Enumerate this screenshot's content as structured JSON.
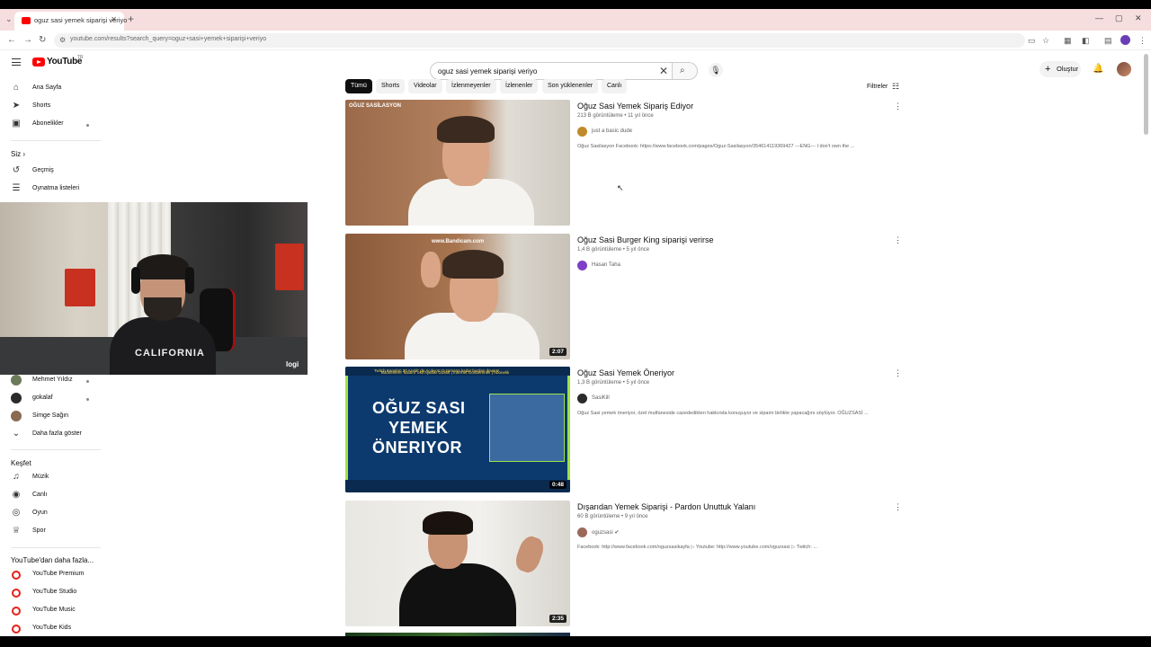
{
  "browser": {
    "tab_title": "oguz sasi yemek siparişi veriyo",
    "url": "youtube.com/results?search_query=oguz+sasi+yemek+siparişi+veriyo"
  },
  "header": {
    "logo": "YouTube",
    "country": "TR",
    "search_value": "oguz sasi yemek siparişi veriyo",
    "create_label": "Oluştur"
  },
  "sidebar": {
    "main": [
      {
        "label": "Ana Sayfa",
        "icon": "home-icon"
      },
      {
        "label": "Shorts",
        "icon": "shorts-icon"
      },
      {
        "label": "Abonelikler",
        "icon": "subscriptions-icon"
      }
    ],
    "you_title": "Siz",
    "you_items": [
      {
        "label": "Geçmiş",
        "icon": "history-icon"
      },
      {
        "label": "Oynatma listeleri",
        "icon": "playlist-icon"
      }
    ],
    "subscriptions": [
      {
        "label": "Mehmet Yıldız"
      },
      {
        "label": "gokalaf"
      },
      {
        "label": "Simge Sağın"
      }
    ],
    "show_more": "Daha fazla göster",
    "explore_title": "Keşfet",
    "explore_items": [
      {
        "label": "Müzik",
        "icon": "music-icon"
      },
      {
        "label": "Canlı",
        "icon": "live-icon"
      },
      {
        "label": "Oyun",
        "icon": "gaming-icon"
      },
      {
        "label": "Spor",
        "icon": "trophy-icon"
      }
    ],
    "more_title": "YouTube'dan daha fazla...",
    "more_items": [
      {
        "label": "YouTube Premium"
      },
      {
        "label": "YouTube Studio"
      },
      {
        "label": "YouTube Music"
      },
      {
        "label": "YouTube Kids"
      }
    ]
  },
  "webcam": {
    "shirt_text": "CALIFORNIA",
    "logo": "logi"
  },
  "chips": [
    "Tümü",
    "Shorts",
    "Videolar",
    "İzlenmeyenler",
    "İzlenenler",
    "Son yüklenenler",
    "Canlı"
  ],
  "filters_label": "Filtreler",
  "results": [
    {
      "title": "Oğuz Sasi Yemek Sipariş Ediyor",
      "meta": "213 B görüntüleme • 11 yıl önce",
      "channel": "just a basic dude",
      "desc": "Oğuz Sasilasyon Facebook: https://www.facebook.com/pages/Oguz-Sasilasyon/354614119369427 ---ENG--- I don't own the ...",
      "thumb_caption": "OĞUZ SASİLASYON",
      "duration": ""
    },
    {
      "title": "Oğuz Sasi Burger King siparişi verirse",
      "meta": "1,4 B görüntüleme • 5 yıl önce",
      "channel": "Hasan Taha",
      "desc": "",
      "thumb_caption": "www.Bandicam.com",
      "duration": "2:07"
    },
    {
      "title": "Oğuz Sasi Yemek Öneriyor",
      "meta": "1,3 B görüntüleme • 5 yıl önce",
      "channel": "SasiKill",
      "desc": "Oğuz Sasi yemek öneriyor, özel mutfaneside cazededikten hakkında konuşuyor ve siparin birlikte yapacağını söylüyor. OĞUZSASİ ...",
      "thumb_lines": [
        "OĞUZ SASI",
        "YEMEK",
        "ÖNERIYOR"
      ],
      "thumb_top": "Twitch Kanalım 30 Aralık' da Açılıyor! O zamana kadar burdan devam!",
      "thumb_bottom": "Bitdirenlere 'kalıtım' ekli Ayarlar Gizlilik | İnternet Gönderenler | Abonelik",
      "duration": "0:48"
    },
    {
      "title": "Dışarıdan Yemek Siparişi - Pardon Unuttuk Yalanı",
      "meta": "60 B görüntüleme • 9 yıl önce",
      "channel": "oguzsasi",
      "desc": "Facebook: http://www.facebook.com/oguzsasikayfa ▷ Youtube: http://www.youtube.com/oguzsasi ▷ Twitch: ...",
      "duration": "2:35"
    }
  ]
}
